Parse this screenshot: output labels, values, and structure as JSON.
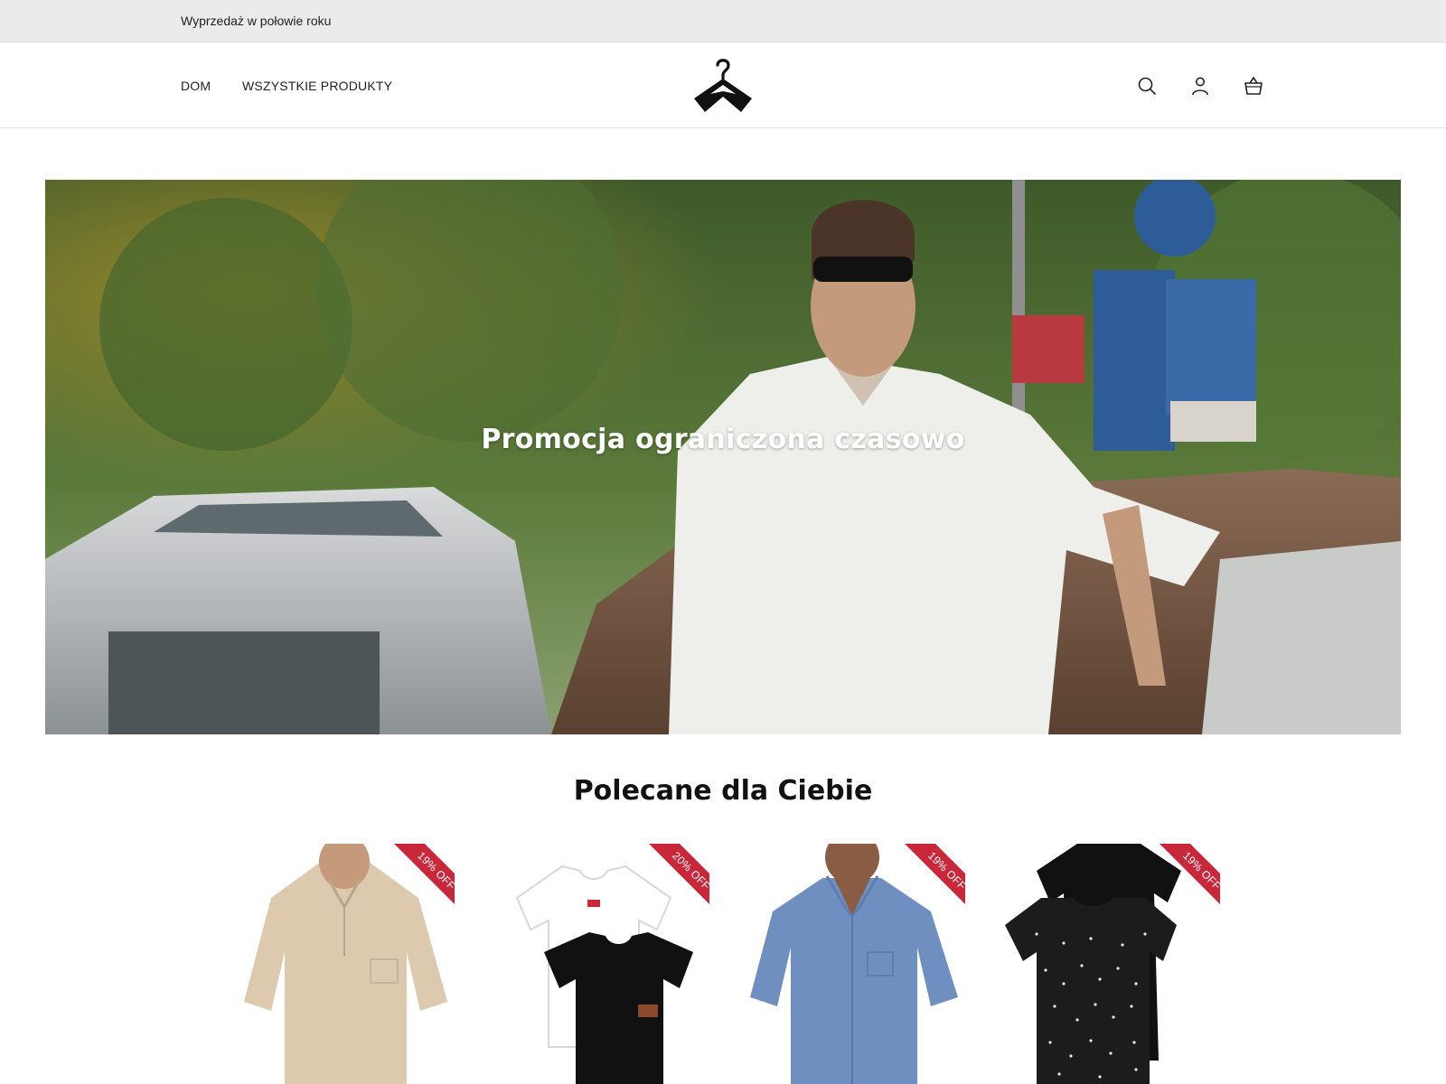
{
  "announcement": {
    "text": "Wyprzedaż w połowie roku"
  },
  "header": {
    "nav": [
      {
        "label": "DOM"
      },
      {
        "label": "WSZYSTKIE PRODUKTY"
      }
    ],
    "icons": [
      "hanger-logo-icon",
      "search-icon",
      "account-icon",
      "cart-icon"
    ]
  },
  "hero": {
    "title": "Promocja ograniczona czasowo"
  },
  "featured": {
    "title": "Polecane dla Ciebie",
    "products": [
      {
        "badge": "19% OFF"
      },
      {
        "badge": "20% OFF"
      },
      {
        "badge": "19% OFF"
      },
      {
        "badge": "19% OFF"
      }
    ]
  },
  "colors": {
    "badge": "#c8283a",
    "announcement_bg": "#ebebeb",
    "text": "#222222"
  }
}
